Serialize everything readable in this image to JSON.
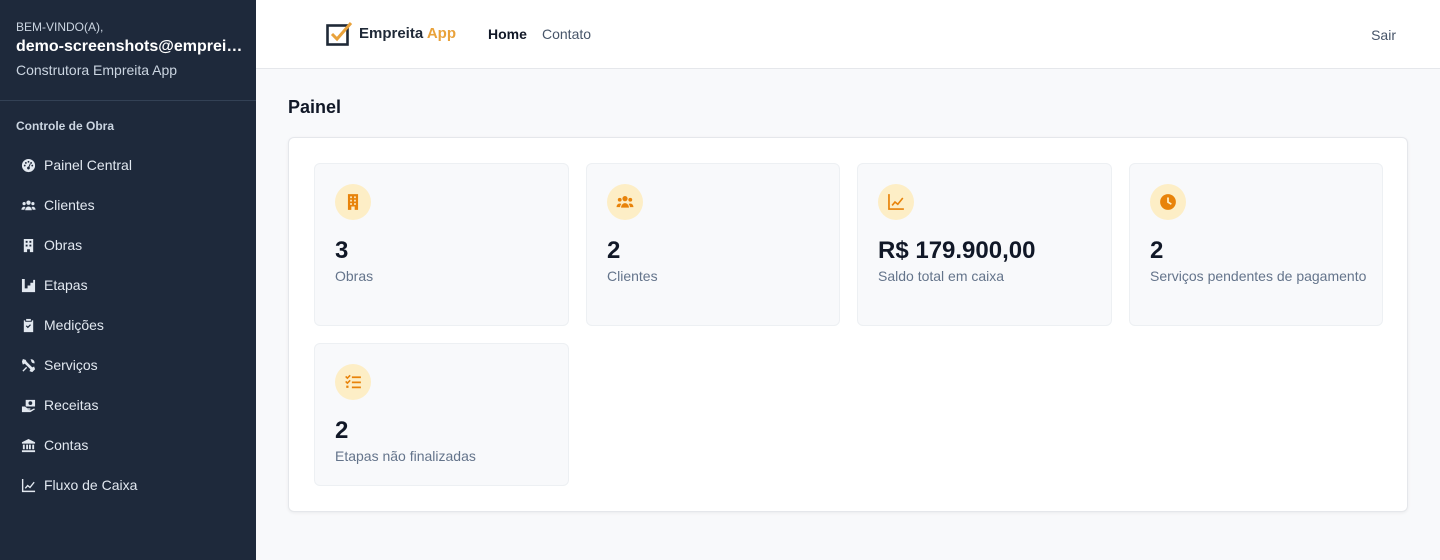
{
  "sidebar": {
    "welcome": "BEM-VINDO(A),",
    "email": "demo-screenshots@empreita...",
    "company": "Construtora Empreita App",
    "section": "Controle de Obra",
    "items": [
      {
        "label": "Painel Central",
        "icon": "dashboard-icon"
      },
      {
        "label": "Clientes",
        "icon": "users-icon"
      },
      {
        "label": "Obras",
        "icon": "building-icon"
      },
      {
        "label": "Etapas",
        "icon": "stairs-icon"
      },
      {
        "label": "Medições",
        "icon": "clipboard-check-icon"
      },
      {
        "label": "Serviços",
        "icon": "tools-icon"
      },
      {
        "label": "Receitas",
        "icon": "money-hand-icon"
      },
      {
        "label": "Contas",
        "icon": "bank-icon"
      },
      {
        "label": "Fluxo de Caixa",
        "icon": "chart-line-icon"
      }
    ]
  },
  "topbar": {
    "logo_main": "Empreita",
    "logo_accent": "App",
    "nav_home": "Home",
    "nav_contato": "Contato",
    "logout": "Sair"
  },
  "main": {
    "title": "Painel",
    "cards": [
      {
        "value": "3",
        "label": "Obras",
        "icon": "building-icon"
      },
      {
        "value": "2",
        "label": "Clientes",
        "icon": "users-icon"
      },
      {
        "value": "R$ 179.900,00",
        "label": "Saldo total em caixa",
        "icon": "chart-line-icon"
      },
      {
        "value": "2",
        "label": "Serviços pendentes de pagamento",
        "icon": "clock-icon"
      },
      {
        "value": "2",
        "label": "Etapas não finalizadas",
        "icon": "checklist-icon"
      }
    ]
  },
  "colors": {
    "sidebar_bg": "#1e293b",
    "accent": "#e9a23b",
    "icon_bg": "#fdeec6",
    "icon_fg": "#e8830a"
  }
}
